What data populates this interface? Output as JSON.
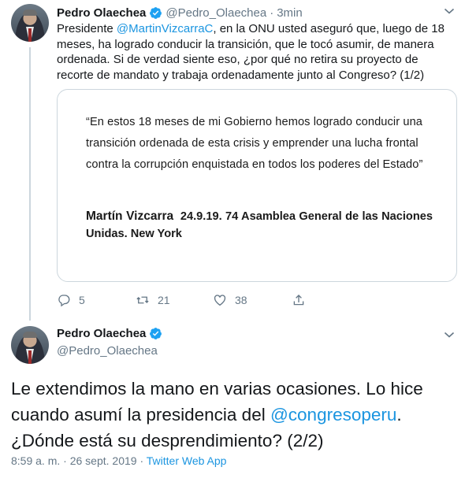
{
  "tweet1": {
    "author_name": "Pedro Olaechea",
    "author_handle": "@Pedro_Olaechea",
    "separator": "·",
    "time": "3min",
    "text_before": "Presidente ",
    "mention": "@MartinVizcarraC",
    "text_after": ",  en la ONU usted aseguró que, luego de 18 meses, ha logrado conducir la transición, que le tocó asumir, de manera ordenada. Si de verdad siente eso, ¿por qué no retira su proyecto de recorte de mandato y trabaja ordenadamente junto al Congreso? (1/2)",
    "quote": {
      "text": "“En estos 18 meses de mi Gobierno hemos logrado conducir una transición ordenada de esta crisis y emprender una lucha frontal contra la corrupción enquistada en todos los poderes del Estado”",
      "signature_name": "Martín Vizcarra",
      "signature_rest": "24.9.19. 74 Asamblea General de las Naciones Unidas. New York"
    },
    "actions": {
      "reply_count": "5",
      "retweet_count": "21",
      "like_count": "38"
    }
  },
  "tweet2": {
    "author_name": "Pedro Olaechea",
    "author_handle": "@Pedro_Olaechea",
    "text_before": "Le extendimos la mano en varias ocasiones. Lo hice cuando asumí la presidencia del ",
    "mention": "@congresoperu",
    "text_after": ". ¿Dónde está su desprendimiento? (2/2)",
    "meta_time": "8:59 a. m.",
    "meta_sep1": " · ",
    "meta_date": "26 sept. 2019",
    "meta_sep2": " · ",
    "meta_source": "Twitter Web App"
  },
  "colors": {
    "accent": "#1b95e0",
    "secondary_text": "#657786",
    "verified": "#1da1f2"
  },
  "icons": [
    "verified-badge-icon",
    "chevron-down-icon",
    "reply-icon",
    "retweet-icon",
    "like-icon",
    "share-icon"
  ]
}
